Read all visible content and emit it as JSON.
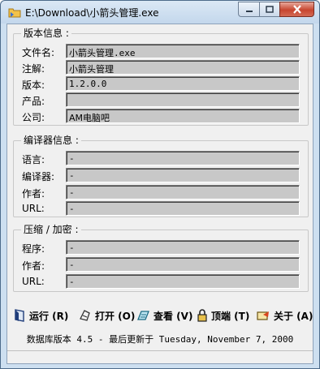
{
  "window": {
    "title": "E:\\Download\\小箭头管理.exe"
  },
  "groups": {
    "version": {
      "title": "版本信息 :",
      "rows": [
        {
          "label": "文件名:",
          "value": "小箭头管理.exe"
        },
        {
          "label": "注解:",
          "value": "小箭头管理"
        },
        {
          "label": "版本:",
          "value": "1.2.0.0"
        },
        {
          "label": "产品:",
          "value": ""
        },
        {
          "label": "公司:",
          "value": "AM电脑吧"
        }
      ]
    },
    "compiler": {
      "title": "编译器信息 :",
      "rows": [
        {
          "label": "语言:",
          "value": "-"
        },
        {
          "label": "编译器:",
          "value": "-"
        },
        {
          "label": "作者:",
          "value": "-"
        },
        {
          "label": "URL:",
          "value": "-"
        }
      ]
    },
    "packer": {
      "title": "压缩 / 加密 :",
      "rows": [
        {
          "label": "程序:",
          "value": "-"
        },
        {
          "label": "作者:",
          "value": "-"
        },
        {
          "label": "URL:",
          "value": "-"
        }
      ]
    }
  },
  "toolbar": {
    "run": "运行 (R)",
    "open": "打开 (O)",
    "view": "查看 (V)",
    "top": "顶端 (T)",
    "about": "关于 (A)"
  },
  "footer": "数据库版本 4.5 - 最后更新于 Tuesday, November 7, 2000",
  "icons": {
    "app": "folder-arrow-icon",
    "run": "run-icon",
    "open": "open-icon",
    "view": "view-icon",
    "top": "lock-icon",
    "about": "about-icon"
  }
}
